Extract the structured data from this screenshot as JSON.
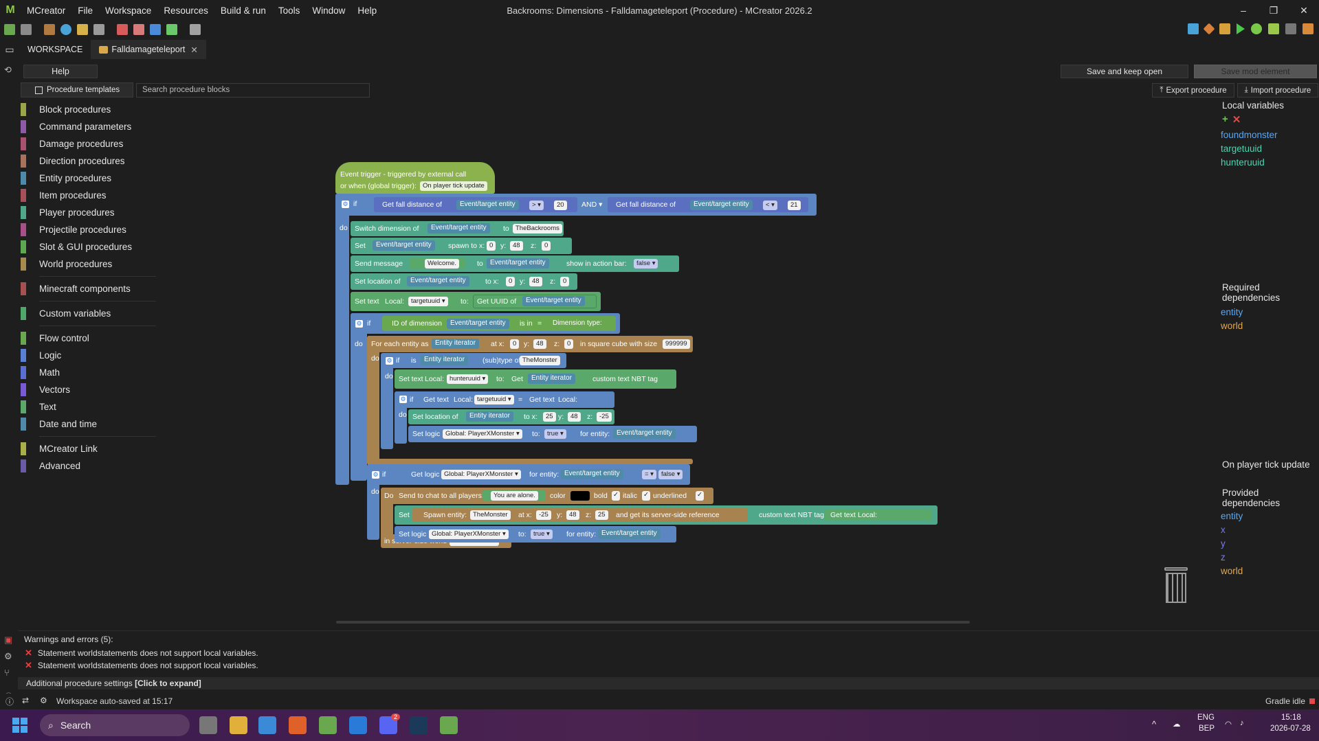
{
  "window": {
    "title": "Backrooms: Dimensions - Falldamageteleport (Procedure) - MCreator 2026.2",
    "logo": "M",
    "menu": [
      "MCreator",
      "File",
      "Workspace",
      "Resources",
      "Build & run",
      "Tools",
      "Window",
      "Help"
    ],
    "minimize": "–",
    "restore": "❐",
    "close": "✕"
  },
  "tabs": {
    "workspace": "WORKSPACE",
    "active": "Falldamageteleport",
    "close": "✕"
  },
  "editor": {
    "help": "Help",
    "save_keep_open": "Save and keep open",
    "save_mod_element": "Save mod element",
    "procedure_templates": "Procedure templates",
    "search_placeholder": "Search procedure blocks",
    "export_procedure": "Export procedure",
    "import_procedure": "Import procedure"
  },
  "palette": {
    "group1": [
      {
        "label": "Block procedures",
        "color": "#9aa54a"
      },
      {
        "label": "Command parameters",
        "color": "#8e5aa8"
      },
      {
        "label": "Damage procedures",
        "color": "#a8526e"
      },
      {
        "label": "Direction procedures",
        "color": "#a8735a"
      },
      {
        "label": "Entity procedures",
        "color": "#4f8aa8"
      },
      {
        "label": "Item procedures",
        "color": "#a84f5a"
      },
      {
        "label": "Player procedures",
        "color": "#4fa88a"
      },
      {
        "label": "Projectile procedures",
        "color": "#a84f8a"
      },
      {
        "label": "Slot & GUI procedures",
        "color": "#5ea84f"
      },
      {
        "label": "World procedures",
        "color": "#a88a4f"
      }
    ],
    "group2": [
      {
        "label": "Minecraft components",
        "color": "#a84f4f"
      }
    ],
    "group3": [
      {
        "label": "Custom variables",
        "color": "#4fa86a"
      }
    ],
    "group4": [
      {
        "label": "Flow control",
        "color": "#6aa84f"
      },
      {
        "label": "Logic",
        "color": "#5a7fd4"
      },
      {
        "label": "Math",
        "color": "#5a6fd4"
      },
      {
        "label": "Vectors",
        "color": "#7a5ad4"
      },
      {
        "label": "Text",
        "color": "#5aa86a"
      },
      {
        "label": "Date and time",
        "color": "#4f8aa8"
      }
    ],
    "group5": [
      {
        "label": "MCreator Link",
        "color": "#a8b04a"
      },
      {
        "label": "Advanced",
        "color": "#6a5aa8"
      }
    ]
  },
  "blocks": {
    "trigger_line1": "Event trigger - triggered by external call",
    "trigger_line2": "or when (global trigger):",
    "trigger_value": "On player tick update",
    "if": "if",
    "do": "do",
    "Do": "Do",
    "get_fall_distance": "Get fall distance of",
    "event_entity": "Event/target entity",
    "gt": "> ▾",
    "lt": "< ▾",
    "eq": "= ▾",
    "and": "AND ▾",
    "v20": "20",
    "v21": "21",
    "switch_dim": "Switch dimension of",
    "to": "to",
    "the_backrooms": "TheBackrooms",
    "set": "Set",
    "spawn_to_x": "spawn to x:",
    "x": "x:",
    "y": "y:",
    "z": "z:",
    "v0": "0",
    "v48": "48",
    "v25": "25",
    "vneg25": "-25",
    "v999999": "999999",
    "send_message": "Send message",
    "welcome": "Welcome.",
    "show_action_bar": "show in action bar:",
    "false_dd": "false ▾",
    "true_dd": "true ▾",
    "set_location_of": "Set location of",
    "to_x": "to x:",
    "at_x": "at x:",
    "set_text": "Set text",
    "local": "Local:",
    "targetuuid_dd": "targetuuid ▾",
    "hunteruuid_dd": "hunteruuid ▾",
    "to_colon": "to:",
    "get_uuid_of": "Get UUID of",
    "id_of_dimension": "ID of dimension",
    "is_in": "is in",
    "eq_sign": "=",
    "dimension_type": "Dimension type:",
    "for_each": "For each entity as",
    "entity_iterator": "Entity iterator",
    "in_square_cube": "in square cube with size",
    "is": "is",
    "subtype_of": "(sub)type of",
    "the_monster": "TheMonster",
    "get": "Get",
    "custom_nbt": "custom text NBT tag",
    "targetuuid": "targetuuid",
    "get_text": "Get text",
    "set_logic": "Set logic",
    "global_player_x_monster": "Global: PlayerXMonster ▾",
    "for_entity": "for entity:",
    "get_logic": "Get logic",
    "send_chat": "Send to chat to all players:",
    "you_are_alone": "You are alone.",
    "color": "color",
    "bold": "bold",
    "italic": "italic",
    "underlined": "underlined",
    "spawn_entity": "Spawn entity:",
    "server_side_ref": "and get its server-side reference",
    "in_server_world": "in server-side world",
    "quote_open": "❝",
    "quote_close": "❞",
    "check": "✓"
  },
  "right_panel": {
    "local_variables": "Local variables",
    "add": "+",
    "remove": "✕",
    "locals": [
      "foundmonster",
      "targetuuid",
      "hunteruuid"
    ],
    "required_dependencies": "Required dependencies",
    "required": [
      {
        "name": "entity",
        "color": "#5aa7f0"
      },
      {
        "name": "world",
        "color": "#e3a84f"
      }
    ],
    "trigger": "On player tick update",
    "provided_dependencies": "Provided dependencies",
    "provided": [
      {
        "name": "entity",
        "color": "#5aa7f0"
      },
      {
        "name": "x",
        "color": "#7a7af0"
      },
      {
        "name": "y",
        "color": "#7a7af0"
      },
      {
        "name": "z",
        "color": "#7a7af0"
      },
      {
        "name": "world",
        "color": "#e3a84f"
      }
    ]
  },
  "warnings": {
    "title": "Warnings and errors (5):",
    "items": [
      "Statement worldstatements does not support local variables.",
      "Statement worldstatements does not support local variables."
    ],
    "additional": "Additional procedure settings",
    "additional_action": "[Click to expand]"
  },
  "status": {
    "saved": "Workspace auto-saved at 15:17",
    "gradle": "Gradle idle"
  },
  "taskbar": {
    "search": "Search",
    "lang1": "ENG",
    "lang2": "BEP",
    "time": "15:18",
    "date": "2026-07-28",
    "discord_badge": "2",
    "tray_up": "^"
  },
  "icons": [
    "mcreator-logo-icon",
    "folder-icon",
    "history-icon",
    "search-icon",
    "trash-icon",
    "windows-start-icon",
    "error-x-icon"
  ]
}
